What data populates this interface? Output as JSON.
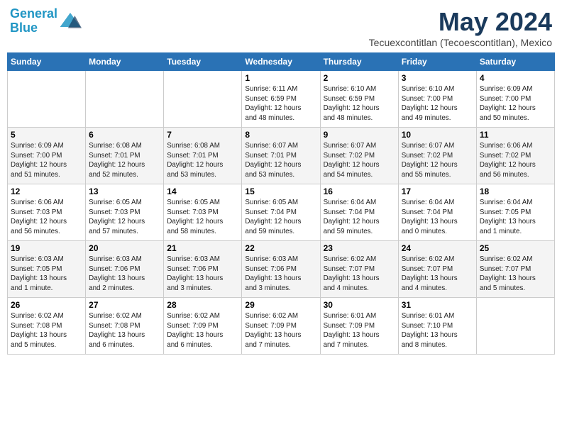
{
  "header": {
    "logo_line1": "General",
    "logo_line2": "Blue",
    "month": "May 2024",
    "location": "Tecuexcontitlan (Tecoescontitlan), Mexico"
  },
  "days_of_week": [
    "Sunday",
    "Monday",
    "Tuesday",
    "Wednesday",
    "Thursday",
    "Friday",
    "Saturday"
  ],
  "weeks": [
    [
      {
        "day": "",
        "info": ""
      },
      {
        "day": "",
        "info": ""
      },
      {
        "day": "",
        "info": ""
      },
      {
        "day": "1",
        "info": "Sunrise: 6:11 AM\nSunset: 6:59 PM\nDaylight: 12 hours\nand 48 minutes."
      },
      {
        "day": "2",
        "info": "Sunrise: 6:10 AM\nSunset: 6:59 PM\nDaylight: 12 hours\nand 48 minutes."
      },
      {
        "day": "3",
        "info": "Sunrise: 6:10 AM\nSunset: 7:00 PM\nDaylight: 12 hours\nand 49 minutes."
      },
      {
        "day": "4",
        "info": "Sunrise: 6:09 AM\nSunset: 7:00 PM\nDaylight: 12 hours\nand 50 minutes."
      }
    ],
    [
      {
        "day": "5",
        "info": "Sunrise: 6:09 AM\nSunset: 7:00 PM\nDaylight: 12 hours\nand 51 minutes."
      },
      {
        "day": "6",
        "info": "Sunrise: 6:08 AM\nSunset: 7:01 PM\nDaylight: 12 hours\nand 52 minutes."
      },
      {
        "day": "7",
        "info": "Sunrise: 6:08 AM\nSunset: 7:01 PM\nDaylight: 12 hours\nand 53 minutes."
      },
      {
        "day": "8",
        "info": "Sunrise: 6:07 AM\nSunset: 7:01 PM\nDaylight: 12 hours\nand 53 minutes."
      },
      {
        "day": "9",
        "info": "Sunrise: 6:07 AM\nSunset: 7:02 PM\nDaylight: 12 hours\nand 54 minutes."
      },
      {
        "day": "10",
        "info": "Sunrise: 6:07 AM\nSunset: 7:02 PM\nDaylight: 12 hours\nand 55 minutes."
      },
      {
        "day": "11",
        "info": "Sunrise: 6:06 AM\nSunset: 7:02 PM\nDaylight: 12 hours\nand 56 minutes."
      }
    ],
    [
      {
        "day": "12",
        "info": "Sunrise: 6:06 AM\nSunset: 7:03 PM\nDaylight: 12 hours\nand 56 minutes."
      },
      {
        "day": "13",
        "info": "Sunrise: 6:05 AM\nSunset: 7:03 PM\nDaylight: 12 hours\nand 57 minutes."
      },
      {
        "day": "14",
        "info": "Sunrise: 6:05 AM\nSunset: 7:03 PM\nDaylight: 12 hours\nand 58 minutes."
      },
      {
        "day": "15",
        "info": "Sunrise: 6:05 AM\nSunset: 7:04 PM\nDaylight: 12 hours\nand 59 minutes."
      },
      {
        "day": "16",
        "info": "Sunrise: 6:04 AM\nSunset: 7:04 PM\nDaylight: 12 hours\nand 59 minutes."
      },
      {
        "day": "17",
        "info": "Sunrise: 6:04 AM\nSunset: 7:04 PM\nDaylight: 13 hours\nand 0 minutes."
      },
      {
        "day": "18",
        "info": "Sunrise: 6:04 AM\nSunset: 7:05 PM\nDaylight: 13 hours\nand 1 minute."
      }
    ],
    [
      {
        "day": "19",
        "info": "Sunrise: 6:03 AM\nSunset: 7:05 PM\nDaylight: 13 hours\nand 1 minute."
      },
      {
        "day": "20",
        "info": "Sunrise: 6:03 AM\nSunset: 7:06 PM\nDaylight: 13 hours\nand 2 minutes."
      },
      {
        "day": "21",
        "info": "Sunrise: 6:03 AM\nSunset: 7:06 PM\nDaylight: 13 hours\nand 3 minutes."
      },
      {
        "day": "22",
        "info": "Sunrise: 6:03 AM\nSunset: 7:06 PM\nDaylight: 13 hours\nand 3 minutes."
      },
      {
        "day": "23",
        "info": "Sunrise: 6:02 AM\nSunset: 7:07 PM\nDaylight: 13 hours\nand 4 minutes."
      },
      {
        "day": "24",
        "info": "Sunrise: 6:02 AM\nSunset: 7:07 PM\nDaylight: 13 hours\nand 4 minutes."
      },
      {
        "day": "25",
        "info": "Sunrise: 6:02 AM\nSunset: 7:07 PM\nDaylight: 13 hours\nand 5 minutes."
      }
    ],
    [
      {
        "day": "26",
        "info": "Sunrise: 6:02 AM\nSunset: 7:08 PM\nDaylight: 13 hours\nand 5 minutes."
      },
      {
        "day": "27",
        "info": "Sunrise: 6:02 AM\nSunset: 7:08 PM\nDaylight: 13 hours\nand 6 minutes."
      },
      {
        "day": "28",
        "info": "Sunrise: 6:02 AM\nSunset: 7:09 PM\nDaylight: 13 hours\nand 6 minutes."
      },
      {
        "day": "29",
        "info": "Sunrise: 6:02 AM\nSunset: 7:09 PM\nDaylight: 13 hours\nand 7 minutes."
      },
      {
        "day": "30",
        "info": "Sunrise: 6:01 AM\nSunset: 7:09 PM\nDaylight: 13 hours\nand 7 minutes."
      },
      {
        "day": "31",
        "info": "Sunrise: 6:01 AM\nSunset: 7:10 PM\nDaylight: 13 hours\nand 8 minutes."
      },
      {
        "day": "",
        "info": ""
      }
    ]
  ]
}
